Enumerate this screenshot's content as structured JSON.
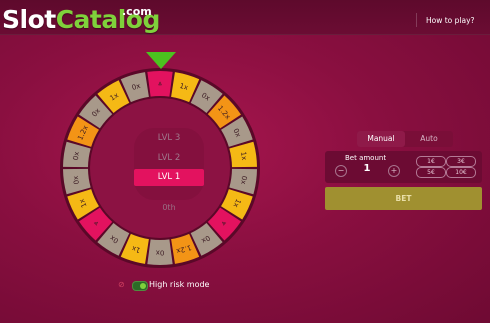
{
  "header": {
    "logo_main": "SlotCatalog",
    "logo_suffix": ".com",
    "how_to_play": "How to play?"
  },
  "wheel": {
    "segments": [
      {
        "label": "⩓",
        "color": "#e3125f"
      },
      {
        "label": "1x",
        "color": "#f5b915"
      },
      {
        "label": "0x",
        "color": "#a8998a"
      },
      {
        "label": "1.2x",
        "color": "#f39416"
      },
      {
        "label": "0x",
        "color": "#a8998a"
      },
      {
        "label": "1x",
        "color": "#f5b915"
      },
      {
        "label": "0x",
        "color": "#a8998a"
      },
      {
        "label": "1x",
        "color": "#f5b915"
      },
      {
        "label": "⩔",
        "color": "#e3125f"
      },
      {
        "label": "0x",
        "color": "#a8998a"
      },
      {
        "label": "1.2x",
        "color": "#f39416"
      },
      {
        "label": "0x",
        "color": "#a8998a"
      },
      {
        "label": "1x",
        "color": "#f5b915"
      },
      {
        "label": "0x",
        "color": "#a8998a"
      },
      {
        "label": "⩔",
        "color": "#e3125f"
      },
      {
        "label": "1x",
        "color": "#f5b915"
      },
      {
        "label": "0x",
        "color": "#a8998a"
      },
      {
        "label": "0x",
        "color": "#a8998a"
      },
      {
        "label": "1.2x",
        "color": "#f39416"
      },
      {
        "label": "0x",
        "color": "#a8998a"
      },
      {
        "label": "1x",
        "color": "#f5b915"
      },
      {
        "label": "0x",
        "color": "#a8998a"
      }
    ],
    "levels": [
      "LVL 3",
      "LVL 2",
      "LVL 1"
    ],
    "active_level": "LVL 1",
    "center_label": "0th"
  },
  "controls": {
    "tabs": [
      "Manual",
      "Auto"
    ],
    "active_tab": "Manual",
    "bet_label": "Bet amount",
    "bet_value": "1",
    "minus": "−",
    "plus": "+",
    "chips": [
      "1€",
      "3€",
      "5€",
      "10€"
    ],
    "bet_button": "BET"
  },
  "risk": {
    "label": "High risk mode",
    "enabled": true
  },
  "colors": {
    "accent_green": "#7fd13b",
    "pink": "#e3125f",
    "gold": "#f5b915",
    "orange": "#f39416",
    "grey": "#a8998a"
  }
}
